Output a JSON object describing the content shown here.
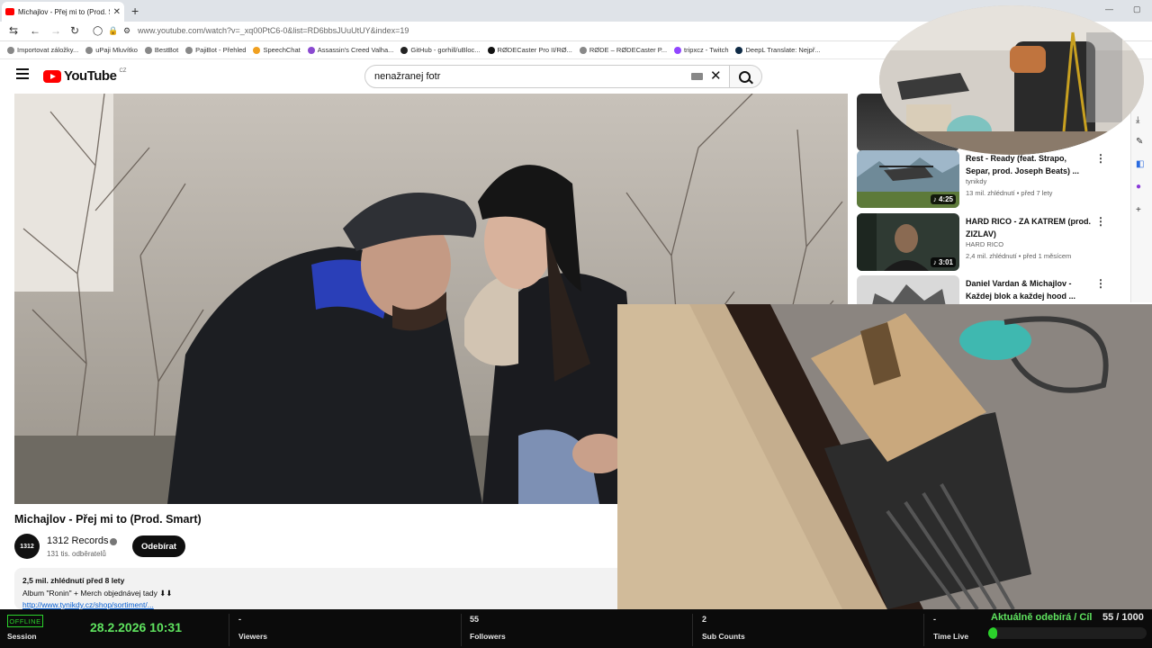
{
  "browser": {
    "tab_title": "Michajlov - Přej mi to (Prod. Sm",
    "tab_close": "✕",
    "new_tab": "+",
    "url": "www.youtube.com/watch?v=_xq00PtC6-0&list=RD6bbsJUuUtUY&index=19",
    "window_controls": [
      "—",
      "▢",
      "✕"
    ],
    "bookmarks": [
      "Importovat záložky...",
      "uPaji Mluvítko",
      "BestBot",
      "PajiBot - Přehled",
      "SpeechChat",
      "Assassin's Creed Valha...",
      "GitHub - gorhill/uBloc...",
      "RØDECaster Pro II/RØ...",
      "RØDE – RØDECaster P...",
      "tripxcz - Twitch",
      "DeepL Translate: Nejpř..."
    ]
  },
  "youtube": {
    "logo_text": "YouTube",
    "logo_country": "CZ",
    "search_value": "nenažranej fotr",
    "search_clear": "✕"
  },
  "video": {
    "title": "Michajlov - Přej mi to (Prod. Smart)",
    "channel_avatar_text": "1312",
    "channel_name": "1312 Records",
    "channel_subs": "131 tis. odběratelů",
    "subscribe_label": "Odebírat",
    "desc_stats": "2,5 mil. zhlédnutí  před 8 lety",
    "desc_line": "Album \"Ronin\" + Merch objednávej tady ⬇⬇",
    "desc_link": "http://www.tynikdy.cz/shop/sortiment/..."
  },
  "sidebar": {
    "items": [
      {
        "title": "Rest - Ready (feat. Strapo, Separ, prod. Joseph Beats) ...",
        "channel": "tynikdy",
        "meta": "13 mil. zhlédnutí • před 7 lety",
        "duration": "♪ 4:25",
        "menu": "⋮"
      },
      {
        "title": "HARD RICO - ZA KATREM (prod. ZIZLAV)",
        "channel": "HARD RICO",
        "meta": "2,4 mil. zhlédnutí • před 1 měsícem",
        "duration": "♪ 3:01",
        "menu": "⋮"
      },
      {
        "title": "Daniel Vardan & Michajlov - Každej blok a každej hood ...",
        "channel": "",
        "meta": "",
        "duration": "",
        "menu": "⋮"
      }
    ]
  },
  "statusbar": {
    "status": "OFFLINE",
    "session_label": "Session",
    "datetime": "28.2.2026 10:31",
    "viewers_value": "-",
    "viewers_label": "Viewers",
    "followers_value": "55",
    "followers_label": "Followers",
    "subcount_value": "2",
    "subcount_label": "Sub Counts",
    "timelive_value": "-",
    "timelive_label": "Time Live",
    "goal_text": "Aktuálně odebírá / Cíl",
    "goal_value": "55 / 1000",
    "goal_progress": 0.055
  },
  "colors": {
    "accent_green": "#2bd22b",
    "youtube_red": "#ff0000"
  }
}
